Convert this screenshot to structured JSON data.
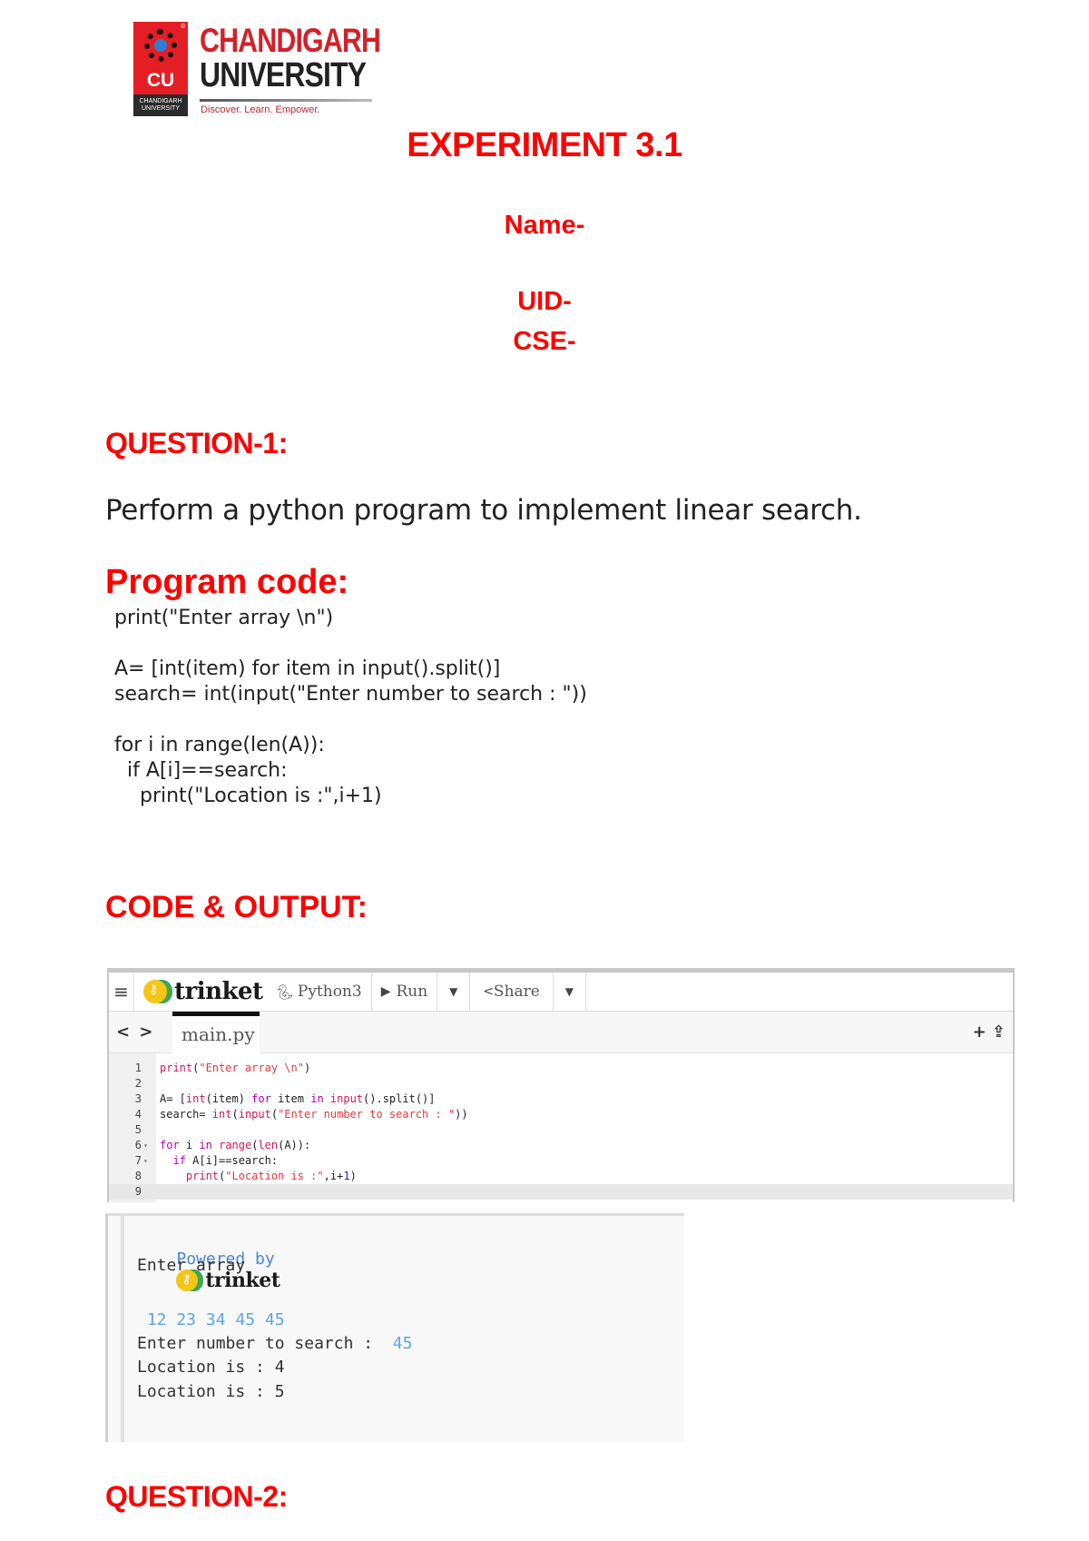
{
  "logo": {
    "line1": "CHANDIGARH",
    "line2": "UNIVERSITY",
    "tagline": "Discover. Learn. Empower.",
    "badge": "CU",
    "badge_caption": "CHANDIGARH UNIVERSITY",
    "registered": "®"
  },
  "header": {
    "title": "EXPERIMENT 3.1",
    "name_label": "Name-",
    "uid_label": "UID-",
    "cse_label": "CSE-"
  },
  "question1": {
    "heading": "QUESTION-1:",
    "text": "Perform a python program to implement linear search."
  },
  "program": {
    "heading": "Program code:",
    "code": "print(\"Enter array \\n\")\n\nA= [int(item) for item in input().split()]\nsearch= int(input(\"Enter number to search : \"))\n\nfor i in range(len(A)):\n  if A[i]==search:\n    print(\"Location is :\",i+1)"
  },
  "code_output": {
    "heading": "CODE & OUTPUT:"
  },
  "trinket": {
    "menu_icon": "≡",
    "brand": "trinket",
    "language": "Python3",
    "run_label": "Run",
    "run_icon": "▶",
    "dropdown_icon": "▼",
    "share_label": "Share",
    "share_icon": "share-icon",
    "nav_arrows": "< >",
    "file_tab": "main.py",
    "tab_actions": "+ ⇪",
    "lines": [
      {
        "n": "1",
        "fold": "",
        "html": "<span class=\"fn\">print</span>(<span class=\"str\">\"Enter array \\n\"</span>)"
      },
      {
        "n": "2",
        "fold": "",
        "html": ""
      },
      {
        "n": "3",
        "fold": "",
        "html": "A= [<span class=\"fn\">int</span>(item) <span class=\"kw\">for</span> item <span class=\"kw\">in</span> <span class=\"fn\">input</span>().split()]"
      },
      {
        "n": "4",
        "fold": "",
        "html": "search= <span class=\"fn\">int</span>(<span class=\"fn\">input</span>(<span class=\"str\">\"Enter number to search : \"</span>))"
      },
      {
        "n": "5",
        "fold": "",
        "html": ""
      },
      {
        "n": "6",
        "fold": "▾",
        "html": "<span class=\"kw\">for</span> i <span class=\"kw\">in</span> <span class=\"fn\">range</span>(<span class=\"fn\">len</span>(A)):"
      },
      {
        "n": "7",
        "fold": "▾",
        "html": "  <span class=\"kw\">if</span> A[i]==search:"
      },
      {
        "n": "8",
        "fold": "",
        "html": "    <span class=\"fn\">print</span>(<span class=\"str\">\"Location is :\"</span>,i+<span class=\"num\">1</span>)"
      },
      {
        "n": "9",
        "fold": "",
        "html": ""
      }
    ],
    "active_line": 9
  },
  "output": {
    "powered_by": "Powered by",
    "brand": "trinket",
    "prompt1": "Enter array",
    "input1": " 12 23 34 45 45",
    "prompt2": "Enter number to search :  ",
    "input2": "45",
    "result1": "Location is : 4",
    "result2": "Location is : 5"
  },
  "question2": {
    "heading": "QUESTION-2:"
  }
}
